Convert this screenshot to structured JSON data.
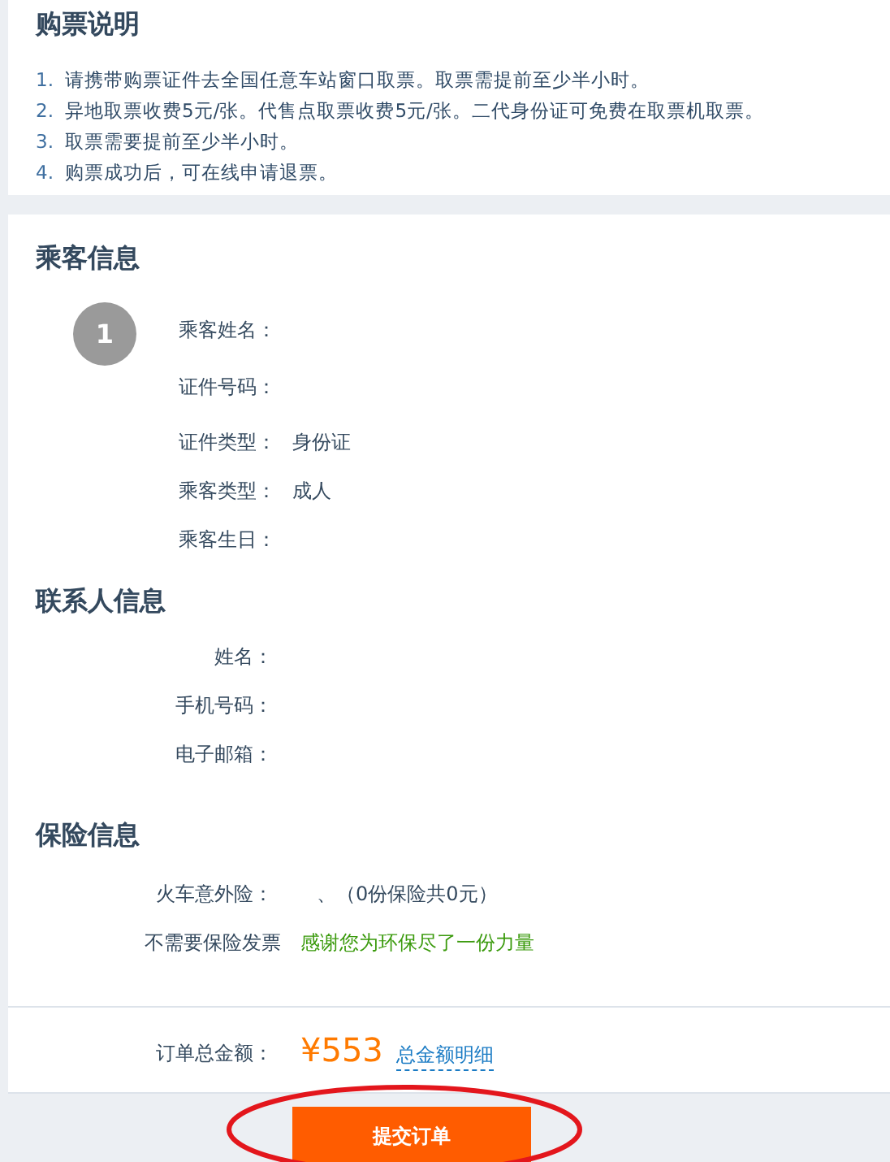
{
  "notice": {
    "title": "购票说明",
    "items": [
      {
        "number": "1.",
        "text": "请携带购票证件去全国任意车站窗口取票。取票需提前至少半小时。"
      },
      {
        "number": "2.",
        "text": "异地取票收费5元/张。代售点取票收费5元/张。二代身份证可免费在取票机取票。"
      },
      {
        "number": "3.",
        "text": "取票需要提前至少半小时。"
      },
      {
        "number": "4.",
        "text": "购票成功后，可在线申请退票。"
      }
    ]
  },
  "passenger": {
    "title": "乘客信息",
    "index": "1",
    "fields": [
      {
        "label": "乘客姓名："
      },
      {
        "label": "证件号码："
      },
      {
        "label": "证件类型：",
        "value": "身份证"
      },
      {
        "label": "乘客类型：",
        "value": "成人"
      },
      {
        "label": "乘客生日："
      }
    ]
  },
  "contact": {
    "title": "联系人信息",
    "fields": [
      {
        "label": "姓名："
      },
      {
        "label": "手机号码："
      },
      {
        "label": "电子邮箱："
      }
    ]
  },
  "insurance": {
    "title": "保险信息",
    "fields": [
      {
        "label": "火车意外险：",
        "value": "、（0份保险共0元）",
        "kind": "plain"
      },
      {
        "label": "不需要保险发票",
        "value": "感谢您为环保尽了一份力量",
        "kind": "note"
      }
    ]
  },
  "total": {
    "label": "订单总金额：",
    "amount": "¥553",
    "link": "总金额明细"
  },
  "submit": {
    "label": "提交订单",
    "highlighted": true
  }
}
